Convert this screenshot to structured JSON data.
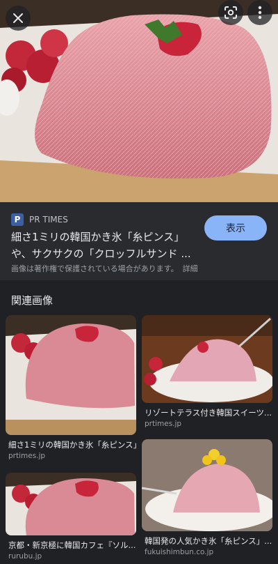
{
  "source": {
    "favicon_letter": "P",
    "site_name": "PR TIMES",
    "title_line1": "細さ1ミリの韓国かき氷「糸ピンス」",
    "title_line2": "や、サクサクの「クロッフルサンド ...",
    "visit_label": "表示",
    "copyright": "画像は著作権で保護されている場合があります。",
    "details_label": "詳細"
  },
  "related": {
    "heading": "関連画像",
    "items": [
      {
        "caption": "細さ1ミリの韓国かき氷「糸ピンス」",
        "domain": "prtimes.jp"
      },
      {
        "caption": "リゾートテラス付き韓国スイーツ...",
        "domain": "prtimes.jp"
      },
      {
        "caption": "京都・新京極に韓国カフェ『ソル...",
        "domain": "rurubu.jp"
      },
      {
        "caption": "韓国発の人気かき氷「糸ピンス」...",
        "domain": "fukuishimbun.co.jp"
      }
    ]
  },
  "icons": {
    "close": "close-icon",
    "lens": "lens-icon",
    "more": "more-vert-icon"
  },
  "colors": {
    "background": "#202124",
    "panel": "#2a2b2e",
    "accent_button": "#8ab4f8",
    "shaved_ice": "#d98a94"
  }
}
